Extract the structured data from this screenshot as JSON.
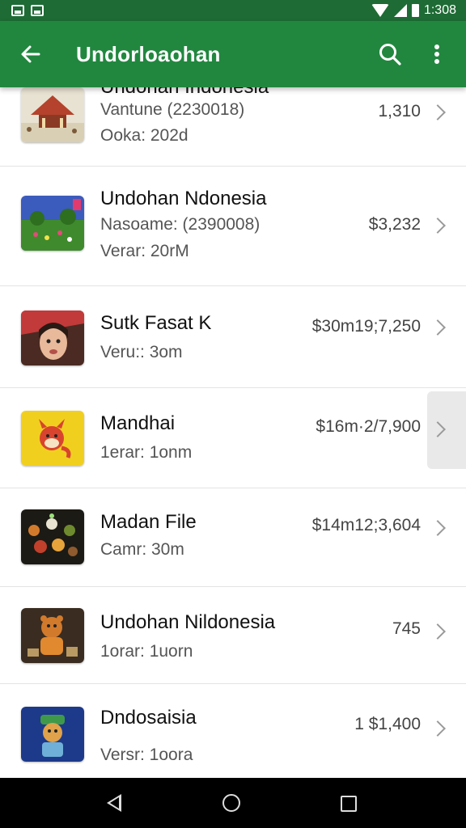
{
  "status_bar": {
    "time": "1:308"
  },
  "app_bar": {
    "title": "Undorloaohan"
  },
  "items": [
    {
      "title": "Undohan Indonesia",
      "line1": "Vantune (2230018)",
      "line2": "Ooka: 202d",
      "price": "1,310",
      "thumb_icon": "pavilion-icon"
    },
    {
      "title": "Undohan Ndonesia",
      "line1": "Nasoame: (2390008)",
      "line2": "Verar: 20rM",
      "price": "$3,232",
      "thumb_icon": "garden-scene-icon"
    },
    {
      "title": "Sutk Fasat K",
      "line1": "Veru:: 3om",
      "line2": "",
      "price": "$30m19;7,250",
      "thumb_icon": "portrait-icon"
    },
    {
      "title": "Mandhai",
      "line1": "1erar: 1onm",
      "line2": "",
      "price": "$16m·2/7,900",
      "thumb_icon": "cartoon-fox-icon"
    },
    {
      "title": "Madan File",
      "line1": "Camr: 30m",
      "line2": "",
      "price": "$14m12;3,604",
      "thumb_icon": "food-plate-icon"
    },
    {
      "title": "Undohan Nildonesia",
      "line1": "1orar: 1uorn",
      "line2": "",
      "price": "745",
      "thumb_icon": "bear-character-icon"
    },
    {
      "title": "Dndosaisia",
      "line1": "Versr: 1oora",
      "line2": "",
      "price": "1 $1,400",
      "thumb_icon": "chef-character-icon"
    }
  ]
}
